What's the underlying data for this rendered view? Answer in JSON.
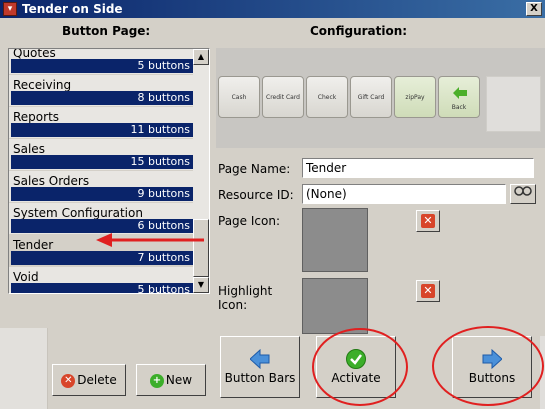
{
  "window": {
    "title": "Tender on Side",
    "close_label": "X"
  },
  "headings": {
    "button_page": "Button Page:",
    "configuration": "Configuration:"
  },
  "button_pages": [
    {
      "name": "Quotes",
      "count": "5 buttons"
    },
    {
      "name": "Receiving",
      "count": "8 buttons"
    },
    {
      "name": "Reports",
      "count": "11 buttons"
    },
    {
      "name": "Sales",
      "count": "15 buttons"
    },
    {
      "name": "Sales Orders",
      "count": "9 buttons"
    },
    {
      "name": "System Configuration",
      "count": "6 buttons"
    },
    {
      "name": "Tender",
      "count": "7 buttons",
      "selected": true
    },
    {
      "name": "Void",
      "count": "5 buttons"
    }
  ],
  "preview_buttons": [
    {
      "label": "Cash"
    },
    {
      "label": "Credit Card"
    },
    {
      "label": "Check"
    },
    {
      "label": "Gift Card"
    },
    {
      "label": "zipPay"
    },
    {
      "label": "Back",
      "icon": "back-arrow-icon"
    }
  ],
  "fields": {
    "page_name_label": "Page Name:",
    "page_name_value": "Tender",
    "resource_id_label": "Resource ID:",
    "resource_id_value": "(None)",
    "page_icon_label": "Page Icon:",
    "highlight_label_1": "Highlight",
    "highlight_label_2": "Icon:"
  },
  "actions": {
    "delete": "Delete",
    "new": "New",
    "button_bars": "Button Bars",
    "activate": "Activate",
    "buttons": "Buttons"
  },
  "colors": {
    "title_bar": "#0a246a",
    "list_count_bar": "#0a246a",
    "annotation": "#e02020",
    "activate_icon": "#3cae2a",
    "nav_arrow": "#4a90d9"
  }
}
